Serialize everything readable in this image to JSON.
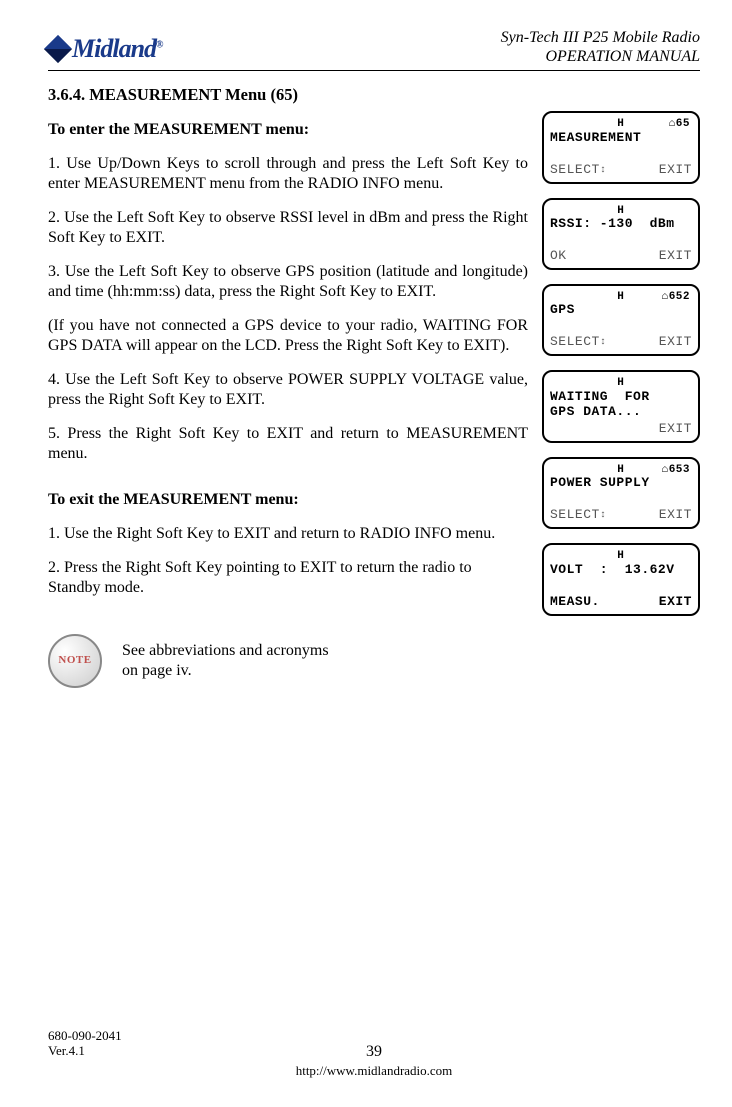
{
  "header": {
    "logo_text": "Midland",
    "title_line1": "Syn-Tech III P25 Mobile Radio",
    "title_line2": "OPERATION MANUAL"
  },
  "section": {
    "heading": "3.6.4.    MEASUREMENT Menu (65)",
    "enter_sub": "To enter the MEASUREMENT menu:",
    "p1": "1. Use Up/Down Keys to scroll through and press the Left Soft Key to enter MEASUREMENT menu from the RADIO INFO menu.",
    "p2": "2. Use the Left Soft Key to observe RSSI level in dBm and press the Right Soft Key to EXIT.",
    "p3": "3. Use the Left Soft Key to observe GPS position (latitude and longitude) and time (hh:mm:ss) data, press the Right Soft Key to EXIT.",
    "p3b": "(If you have not connected a GPS device to your radio, WAITING FOR GPS DATA will appear on the LCD. Press the Right Soft Key to EXIT).",
    "p4": "4. Use the Left Soft Key to observe POWER SUPPLY VOLTAGE value, press the Right Soft Key to EXIT.",
    "p5": "5. Press the Right Soft Key to EXIT and return to MEASUREMENT menu.",
    "exit_sub": "To exit the MEASUREMENT menu:",
    "e1": "1. Use the Right Soft Key to EXIT and return to RADIO INFO menu.",
    "e2": "2. Press the Right Soft Key pointing to EXIT to return the radio to Standby mode."
  },
  "lcds": [
    {
      "hdr": "H",
      "num": "⌂65",
      "l1": "MEASUREMENT",
      "l2": "",
      "left": "SELECT",
      "right": "EXIT",
      "arrows": true,
      "bold_main": true,
      "bold_bottom": false
    },
    {
      "hdr": "H",
      "num": "",
      "l1": "RSSI: -130  dBm",
      "l2": "",
      "left": "OK",
      "right": "EXIT",
      "arrows": false,
      "bold_main": true,
      "bold_bottom": false
    },
    {
      "hdr": "H",
      "num": "⌂652",
      "l1": "GPS",
      "l2": "",
      "left": "SELECT",
      "right": "EXIT",
      "arrows": true,
      "bold_main": true,
      "bold_bottom": false
    },
    {
      "hdr": "H",
      "num": "",
      "l1": "WAITING  FOR",
      "l2": "GPS DATA...",
      "left": "",
      "right": "EXIT",
      "arrows": false,
      "bold_main": true,
      "bold_bottom": false
    },
    {
      "hdr": "H",
      "num": "⌂653",
      "l1": "POWER SUPPLY",
      "l2": "",
      "left": "SELECT",
      "right": "EXIT",
      "arrows": true,
      "bold_main": true,
      "bold_bottom": false
    },
    {
      "hdr": "H",
      "num": "",
      "l1": "VOLT  :  13.62V",
      "l2": "",
      "left": "MEASU.",
      "right": "EXIT",
      "arrows": false,
      "bold_main": true,
      "bold_bottom": true
    }
  ],
  "note": {
    "icon_label": "NOTE",
    "text_l1": "See abbreviations and acronyms",
    "text_l2": "on page iv."
  },
  "footer": {
    "doc_num": "680-090-2041",
    "version": "Ver.4.1",
    "page_num": "39",
    "url": "http://www.midlandradio.com"
  }
}
